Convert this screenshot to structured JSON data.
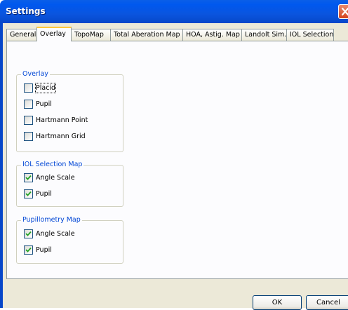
{
  "window": {
    "title": "Settings"
  },
  "tabs": [
    {
      "label": "General"
    },
    {
      "label": "Overlay"
    },
    {
      "label": "TopoMap"
    },
    {
      "label": "Total Aberation Map"
    },
    {
      "label": "HOA, Astig. Map"
    },
    {
      "label": "Landolt Sim."
    },
    {
      "label": "IOL Selection"
    }
  ],
  "active_tab": "Overlay",
  "groups": {
    "overlay": {
      "title": "Overlay",
      "items": [
        {
          "label": "Placid",
          "checked": false
        },
        {
          "label": "Pupil",
          "checked": false
        },
        {
          "label": "Hartmann Point",
          "checked": false
        },
        {
          "label": "Hartmann Grid",
          "checked": false
        }
      ]
    },
    "iol_selection_map": {
      "title": "IOL Selection Map",
      "items": [
        {
          "label": "Angle Scale",
          "checked": true
        },
        {
          "label": "Pupil",
          "checked": true
        }
      ]
    },
    "pupillometry_map": {
      "title": "Pupillometry Map",
      "items": [
        {
          "label": "Angle Scale",
          "checked": true
        },
        {
          "label": "Pupil",
          "checked": true
        }
      ]
    }
  },
  "buttons": {
    "ok": "OK",
    "cancel": "Cancel"
  },
  "colors": {
    "titlebar": "#0054e3",
    "group_title": "#0046d5",
    "tab_highlight": "#ffc83c",
    "dialog_bg": "#ece9d8"
  }
}
